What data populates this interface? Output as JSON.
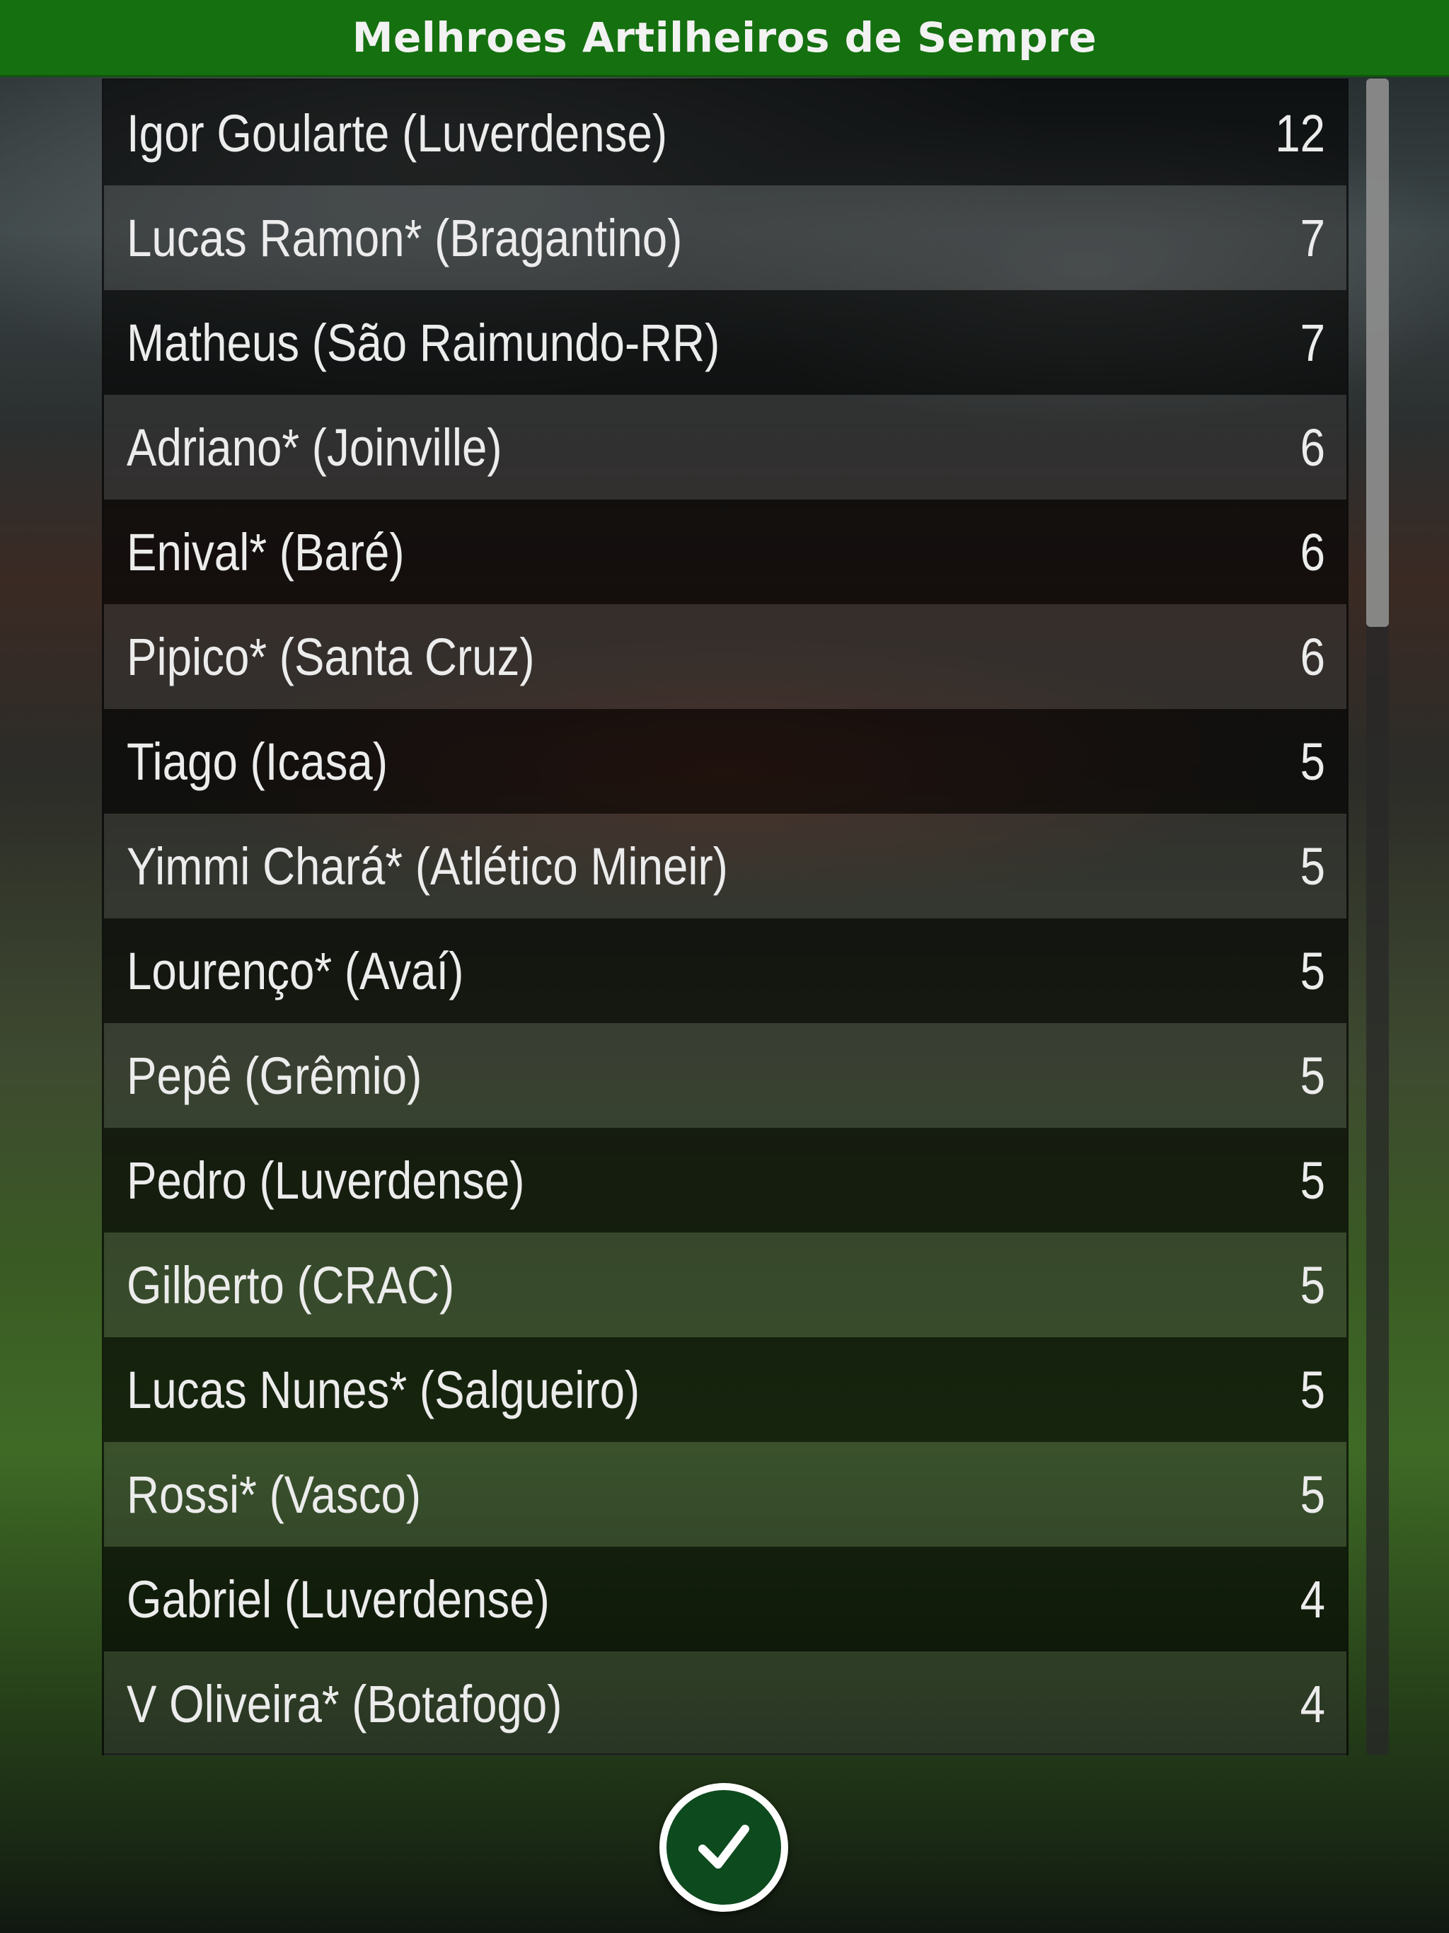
{
  "header": {
    "title": "Melhroes Artilheiros de Sempre"
  },
  "scorers": [
    {
      "player": "Igor Goularte (Luverdense)",
      "goals": "12"
    },
    {
      "player": "Lucas Ramon* (Bragantino)",
      "goals": "7"
    },
    {
      "player": "Matheus (São Raimundo-RR)",
      "goals": "7"
    },
    {
      "player": "Adriano* (Joinville)",
      "goals": "6"
    },
    {
      "player": "Enival* (Baré)",
      "goals": "6"
    },
    {
      "player": "Pipico* (Santa Cruz)",
      "goals": "6"
    },
    {
      "player": "Tiago (Icasa)",
      "goals": "5"
    },
    {
      "player": "Yimmi Chará* (Atlético Mineir)",
      "goals": "5"
    },
    {
      "player": "Lourenço* (Avaí)",
      "goals": "5"
    },
    {
      "player": "Pepê (Grêmio)",
      "goals": "5"
    },
    {
      "player": "Pedro (Luverdense)",
      "goals": "5"
    },
    {
      "player": "Gilberto (CRAC)",
      "goals": "5"
    },
    {
      "player": "Lucas Nunes* (Salgueiro)",
      "goals": "5"
    },
    {
      "player": "Rossi* (Vasco)",
      "goals": "5"
    },
    {
      "player": "Gabriel (Luverdense)",
      "goals": "4"
    },
    {
      "player": "V Oliveira* (Botafogo)",
      "goals": "4"
    }
  ],
  "footer": {
    "confirm_icon": "checkmark-icon"
  },
  "colors": {
    "header_green": "#157010",
    "button_fill": "#0d4a1e",
    "button_ring": "#ffffff"
  }
}
